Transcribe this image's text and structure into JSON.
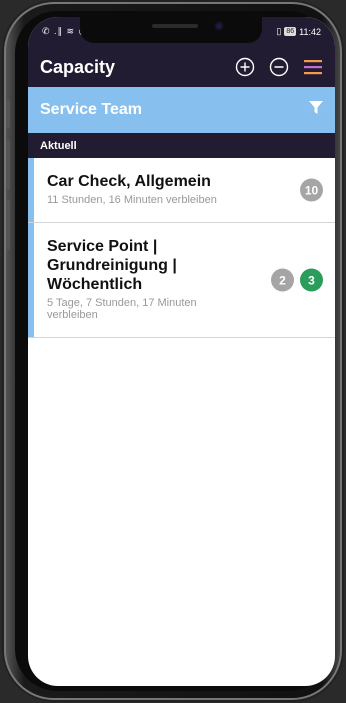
{
  "status_bar": {
    "left": "✆ .∥ ≋ ◷ :",
    "battery": "86",
    "time": "11:42"
  },
  "app_bar": {
    "title": "Capacity",
    "icons": [
      "plus-circle-icon",
      "minus-circle-icon",
      "menu-icon"
    ]
  },
  "filter_bar": {
    "title": "Service Team",
    "icon": "filter-icon"
  },
  "section": {
    "label": "Aktuell"
  },
  "items": [
    {
      "title": "Car Check, Allgemein",
      "remaining": "11 Stunden, 16 Minuten verbleiben",
      "badges": [
        {
          "value": "10",
          "color": "#a5a5a5"
        }
      ]
    },
    {
      "title": "Service Point | Grundreinigung | Wöchentlich",
      "remaining": "5 Tage, 7 Stunden, 17 Minuten verbleiben",
      "badges": [
        {
          "value": "2",
          "color": "#a5a5a5"
        },
        {
          "value": "3",
          "color": "#2a9d5c"
        }
      ]
    }
  ],
  "colors": {
    "app_bar": "#221c33",
    "filter_bar": "#87c0ef",
    "accent_menu": "#f29b4c",
    "badge_green": "#2a9d5c"
  }
}
